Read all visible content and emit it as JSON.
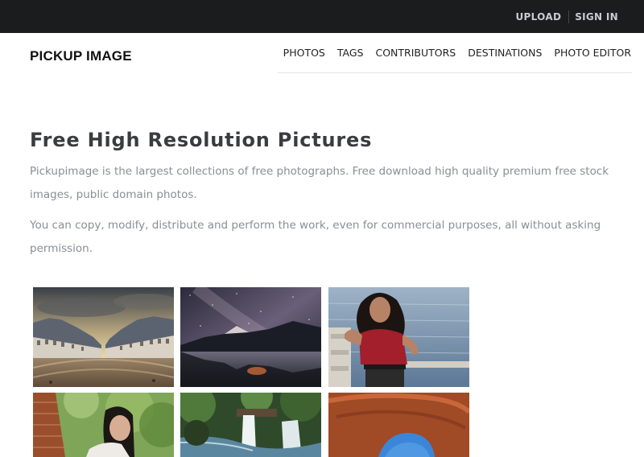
{
  "topbar": {
    "upload_label": "UPLOAD",
    "signin_label": "SIGN IN"
  },
  "header": {
    "logo": "PICKUP IMAGE"
  },
  "nav": {
    "items": [
      "PHOTOS",
      "TAGS",
      "CONTRIBUTORS",
      "DESTINATIONS",
      "PHOTO EDITOR"
    ]
  },
  "main": {
    "title": "Free High Resolution Pictures",
    "intro": "Pickupimage is the largest collections of free photographs. Free download high quality premium free stock images, public domain photos.",
    "license": "You can copy, modify, distribute and perform the work, even for commercial purposes, all without asking permission."
  },
  "gallery": {
    "photos": [
      {
        "subject": "town-square-photo"
      },
      {
        "subject": "milky-way-lake-photo"
      },
      {
        "subject": "woman-red-shirt-photo"
      },
      {
        "subject": "woman-portrait-photo"
      },
      {
        "subject": "waterfall-photo"
      },
      {
        "subject": "rock-arch-photo"
      }
    ]
  },
  "colors": {
    "topbar": "#1b1c1e",
    "title": "#3a3c3f",
    "body_text": "#8a8e93"
  }
}
